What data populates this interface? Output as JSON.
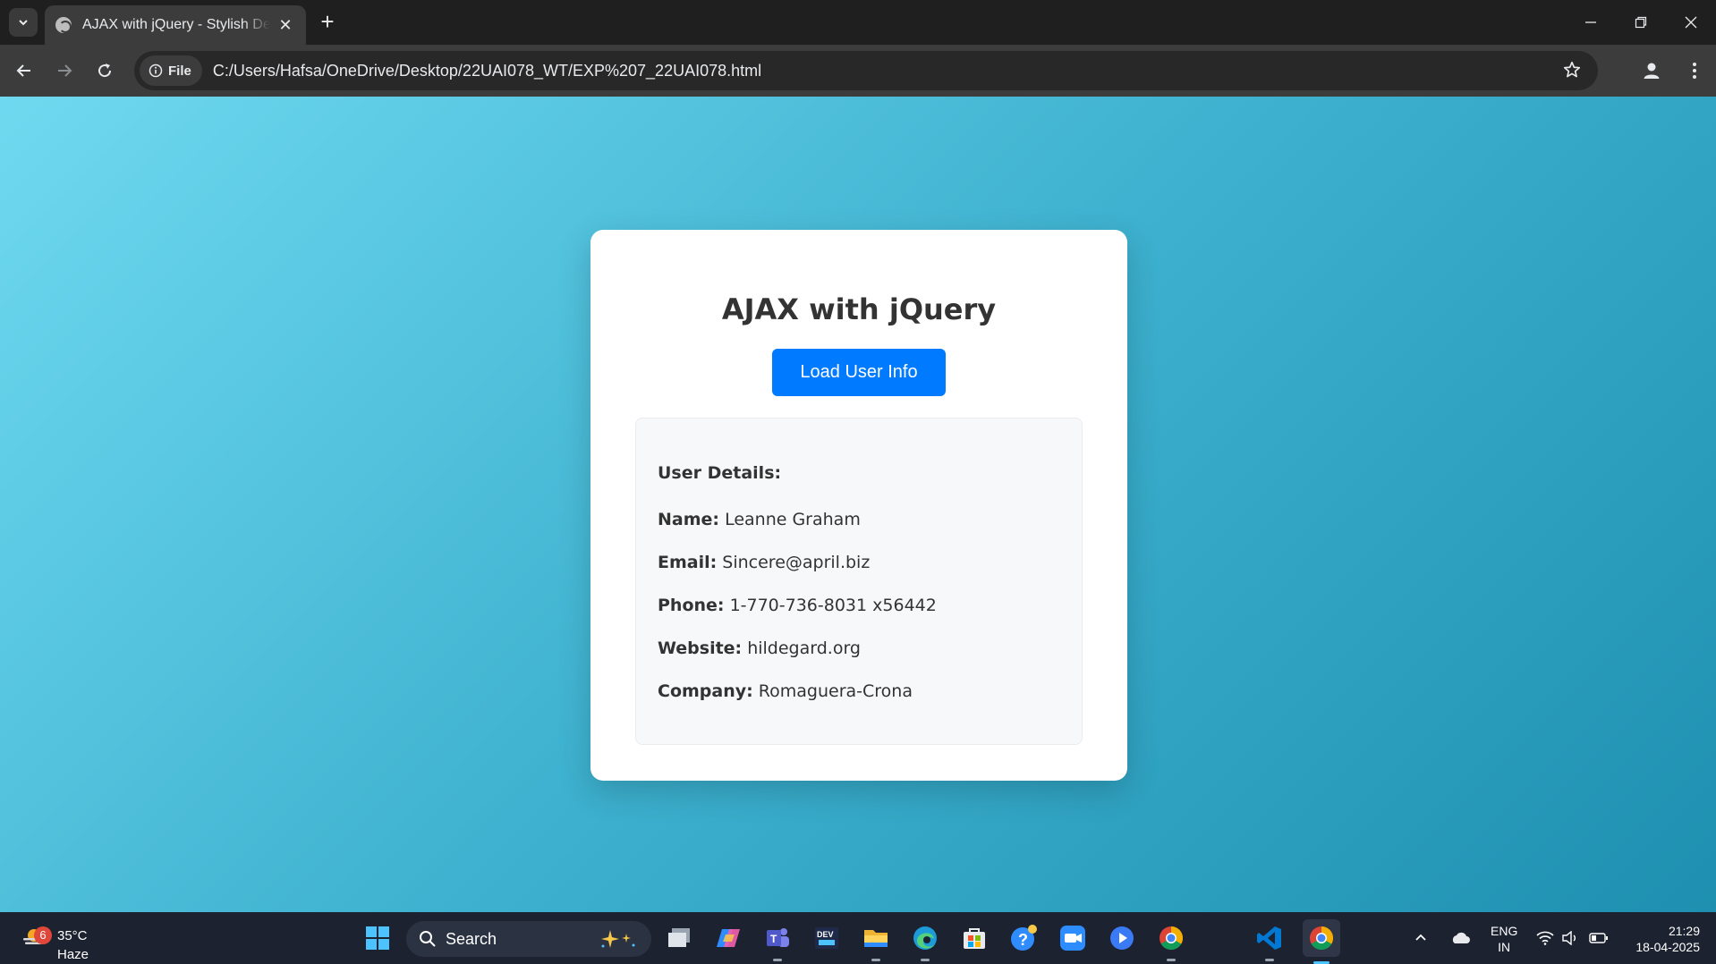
{
  "browser": {
    "tab_title": "AJAX with jQuery - Stylish Demo",
    "site_chip_label": "File",
    "url": "C:/Users/Hafsa/OneDrive/Desktop/22UAI078_WT/EXP%207_22UAI078.html"
  },
  "page": {
    "title": "AJAX with jQuery",
    "button_label": "Load User Info",
    "details_heading": "User Details:",
    "fields": [
      {
        "label": "Name:",
        "value": "Leanne Graham"
      },
      {
        "label": "Email:",
        "value": "Sincere@april.biz"
      },
      {
        "label": "Phone:",
        "value": "1-770-736-8031 x56442"
      },
      {
        "label": "Website:",
        "value": "hildegard.org"
      },
      {
        "label": "Company:",
        "value": "Romaguera-Crona"
      }
    ]
  },
  "taskbar": {
    "weather_badge": "6",
    "weather_temp": "35°C",
    "weather_condition": "Haze",
    "search_placeholder": "Search",
    "language": "ENG",
    "region": "IN",
    "time": "21:29",
    "date": "18-04-2025"
  },
  "colors": {
    "button": "#007bff",
    "gradient_start": "#6fd9f0",
    "gradient_end": "#1e8fb0"
  }
}
